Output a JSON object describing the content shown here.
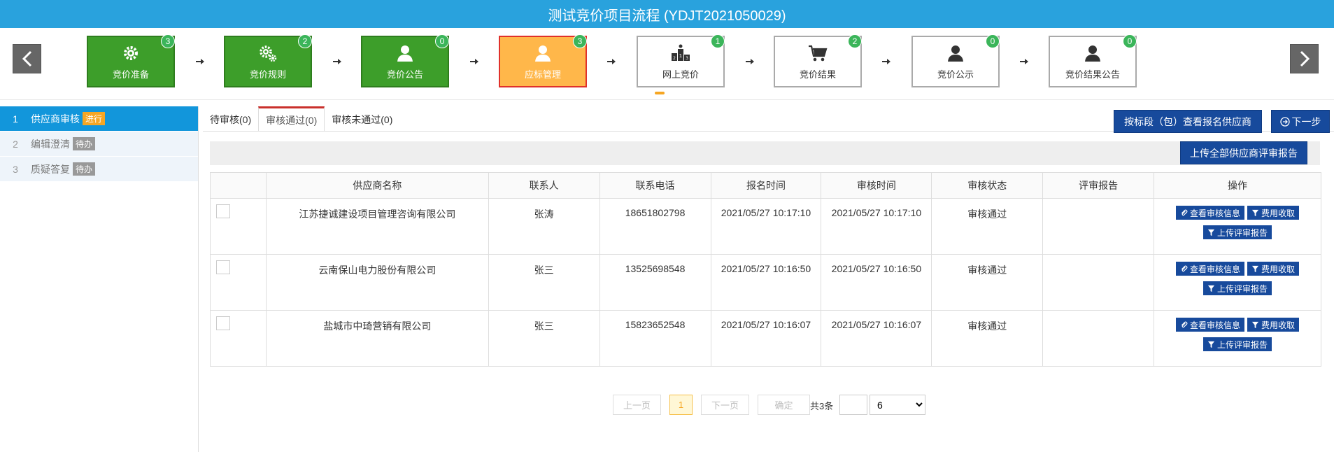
{
  "title": "测试竞价项目流程 (YDJT2021050029)",
  "steps": [
    {
      "label": "竞价准备",
      "count": "3",
      "state": "done",
      "icon": "gear-icon"
    },
    {
      "label": "竞价规则",
      "count": "2",
      "state": "done",
      "icon": "gears-icon"
    },
    {
      "label": "竞价公告",
      "count": "0",
      "state": "done",
      "icon": "user-icon"
    },
    {
      "label": "应标管理",
      "count": "3",
      "state": "current",
      "icon": "user-icon"
    },
    {
      "label": "网上竞价",
      "count": "1",
      "state": "todo",
      "icon": "podium-icon"
    },
    {
      "label": "竞价结果",
      "count": "2",
      "state": "todo",
      "icon": "cart-icon"
    },
    {
      "label": "竞价公示",
      "count": "0",
      "state": "todo",
      "icon": "user-icon"
    },
    {
      "label": "竞价结果公告",
      "count": "0",
      "state": "todo",
      "icon": "user-icon"
    }
  ],
  "sidebar": {
    "items": [
      {
        "num": "1",
        "label": "供应商审核",
        "tag": "进行"
      },
      {
        "num": "2",
        "label": "编辑澄清",
        "tag": "待办"
      },
      {
        "num": "3",
        "label": "质疑答复",
        "tag": "待办"
      }
    ]
  },
  "tabs": [
    {
      "label": "待审核(0)"
    },
    {
      "label": "审核通过(0)"
    },
    {
      "label": "审核未通过(0)"
    }
  ],
  "buttons": {
    "view_by_section": "按标段（包）查看报名供应商",
    "next_step": "下一步",
    "upload_all": "上传全部供应商评审报告"
  },
  "table": {
    "headers": [
      "",
      "供应商名称",
      "联系人",
      "联系电话",
      "报名时间",
      "审核时间",
      "审核状态",
      "评审报告",
      "操作"
    ],
    "rows": [
      {
        "name": "江苏捷诚建设项目管理咨询有限公司",
        "contact": "张涛",
        "phone": "18651802798",
        "signup": "2021/05/27 10:17:10",
        "audit": "2021/05/27 10:17:10",
        "status": "审核通过",
        "report": ""
      },
      {
        "name": "云南保山电力股份有限公司",
        "contact": "张三",
        "phone": "13525698548",
        "signup": "2021/05/27 10:16:50",
        "audit": "2021/05/27 10:16:50",
        "status": "审核通过",
        "report": ""
      },
      {
        "name": "盐城市中琦营销有限公司",
        "contact": "张三",
        "phone": "15823652548",
        "signup": "2021/05/27 10:16:07",
        "audit": "2021/05/27 10:16:07",
        "status": "审核通过",
        "report": ""
      }
    ],
    "ops": {
      "view": "查看审核信息",
      "fee": "费用收取",
      "upload": "上传评审报告"
    }
  },
  "pager": {
    "prev": "上一页",
    "current": "1",
    "next": "下一页",
    "confirm": "确定",
    "total": "共3条",
    "page_size": "6",
    "page_size_options": [
      "6"
    ]
  },
  "colors": {
    "title_bg": "#29a2dd",
    "done_step": "#3d9e2a",
    "current_step": "#ffb74a",
    "primary_button": "#174a9c",
    "badge": "#3bb55a"
  }
}
